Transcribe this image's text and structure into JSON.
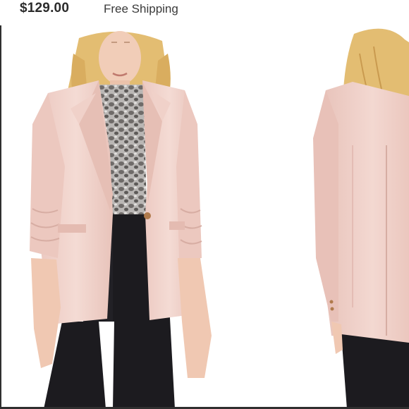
{
  "listing": {
    "price": "$129.00",
    "shipping": "Free Shipping"
  },
  "product_image": {
    "subject": "blush pink single-button blazer shown front and back on model",
    "colors": {
      "blazer": "#f2d6cf",
      "blazer_shadow": "#e2bdb3",
      "pants": "#1c1b1f",
      "top": "#9e9a98",
      "hair": "#e6c27a",
      "skin": "#f1cdb8",
      "button": "#b07a4c"
    }
  }
}
